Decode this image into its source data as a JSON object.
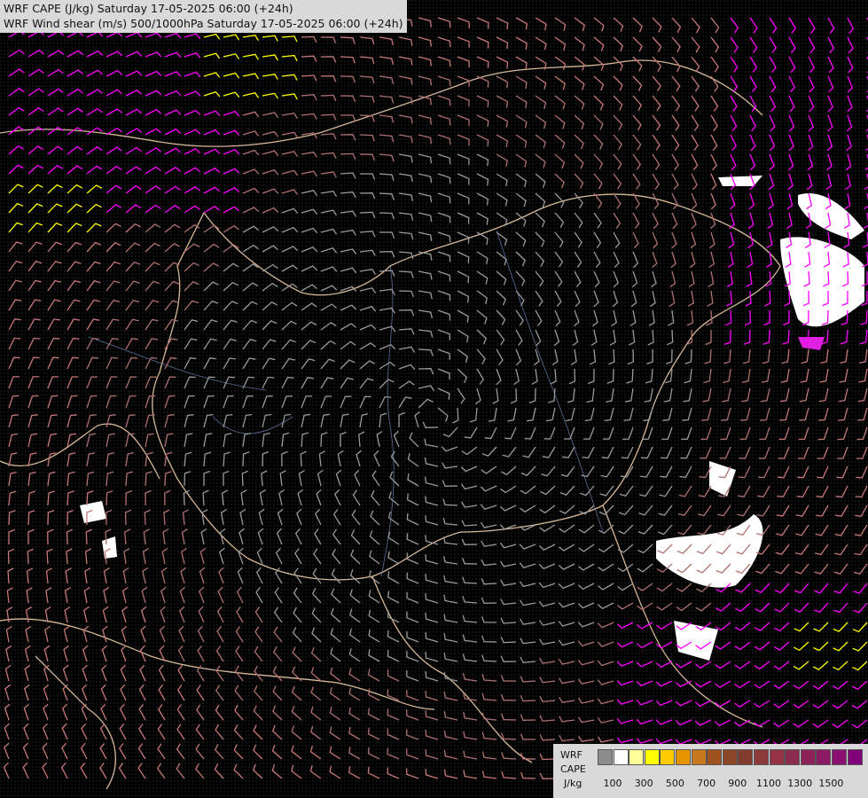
{
  "title": {
    "line1": "WRF CAPE (J/kg) Saturday 17-05-2025 06:00 (+24h)",
    "line2": "WRF Wind shear (m/s) 500/1000hPa Saturday 17-05-2025 06:00 (+24h)"
  },
  "legend": {
    "label_model": "WRF",
    "label_var": "CAPE",
    "label_unit": "J/kg",
    "colors": [
      "#8c8c8c",
      "#ffffff",
      "#ffff99",
      "#ffff00",
      "#ffcc00",
      "#e69500",
      "#c8781e",
      "#a0521e",
      "#8c4628",
      "#823c2d",
      "#8c3a3a",
      "#963246",
      "#8c2a50",
      "#8c225a",
      "#8c1a64",
      "#8c1070",
      "#80007a"
    ],
    "tick_labels": [
      "100",
      "300",
      "500",
      "700",
      "900",
      "1100",
      "1300",
      "1500"
    ]
  },
  "map": {
    "background": "#000000",
    "region": "Hungary and surroundings",
    "cape_patches": "white/magenta cells in east",
    "barb_colors": [
      "#9a9a9a",
      "#b07070",
      "#c87878",
      "#e060a0",
      "#ff00ff",
      "#ffff00"
    ]
  }
}
